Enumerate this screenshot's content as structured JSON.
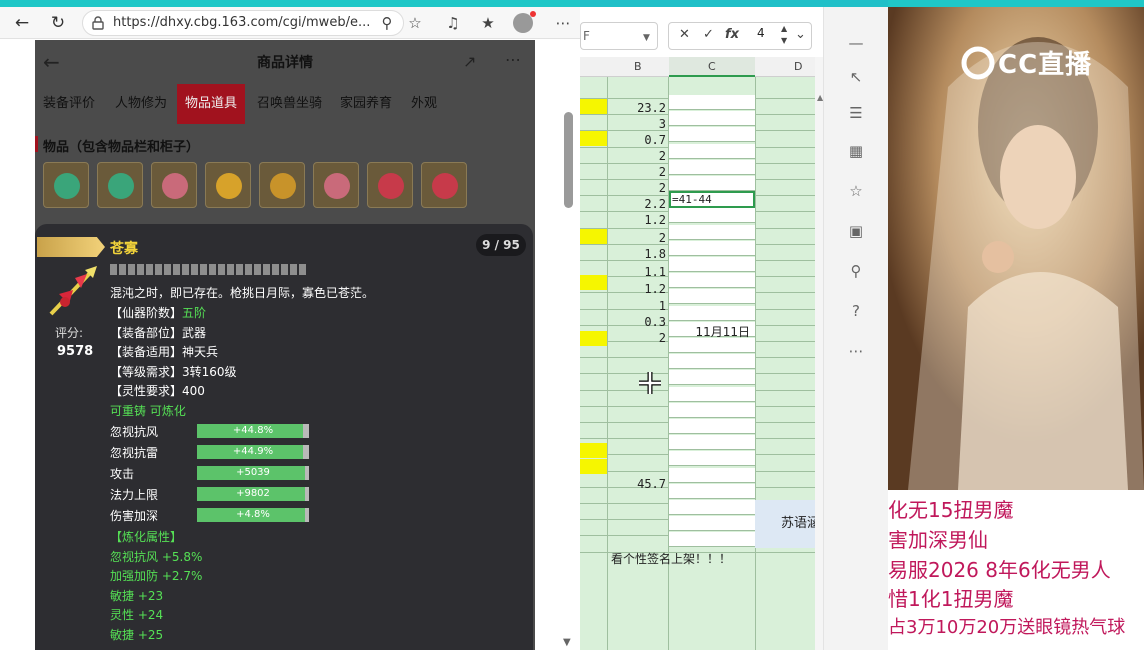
{
  "browser": {
    "url": "https://dhxy.cbg.163.com/cgi/mweb/e...",
    "page_title": "商品详情",
    "tabs": [
      {
        "label": "装备评价"
      },
      {
        "label": "人物修为"
      },
      {
        "label": "物品道具"
      },
      {
        "label": "召唤兽坐骑"
      },
      {
        "label": "家园养育"
      },
      {
        "label": "外观"
      }
    ],
    "section_title": "物品（包含物品栏和柜子）"
  },
  "tooltip": {
    "name": "苍寡",
    "count": "9 / 95",
    "score_label": "评分:",
    "score": "9578",
    "desc": "混沌之时，即已存在。枪挑日月际，寡色已苍茫。",
    "attrs": [
      {
        "key": "【仙器阶数】",
        "val": "五阶",
        "green": true
      },
      {
        "key": "【装备部位】",
        "val": "武器",
        "green": false
      },
      {
        "key": "【装备适用】",
        "val": "神天兵",
        "green": false
      },
      {
        "key": "【等级需求】",
        "val": "3转160级",
        "green": false
      },
      {
        "key": "【灵性要求】",
        "val": "400",
        "green": false
      }
    ],
    "forge": "可重铸 可炼化",
    "stats": [
      {
        "label": "忽视抗风",
        "value": "+44.8%",
        "fill": 0.95
      },
      {
        "label": "忽视抗雷",
        "value": "+44.9%",
        "fill": 0.95
      },
      {
        "label": "攻击",
        "value": "+5039",
        "fill": 0.96
      },
      {
        "label": "法力上限",
        "value": "+9802",
        "fill": 0.96
      },
      {
        "label": "伤害加深",
        "value": "+4.8%",
        "fill": 0.96
      }
    ],
    "refine_title": "【炼化属性】",
    "refine": [
      "忽视抗风 +5.8%",
      "加强加防 +2.7%",
      "敏捷 +23",
      "灵性 +24",
      "敏捷 +25"
    ]
  },
  "sheet": {
    "namebox": "F",
    "formula_value": "4",
    "col_headers": [
      "B",
      "C",
      "D"
    ],
    "b_values": [
      "23.2",
      "3",
      "0.7",
      "2",
      "2",
      "2",
      "2.2",
      "1.2",
      "2",
      "1.8",
      "1.1",
      "1.2",
      "1",
      "0.3",
      "2"
    ],
    "b_total": "45.7",
    "active_cell_text": "=41-44",
    "date_cell": "11月11日",
    "name_cell": "苏语涵",
    "note_cell": "看个性签名上架！！！"
  },
  "stream": {
    "logo": "CC直播",
    "lines": [
      "化无15扭男魔",
      "害加深男仙",
      "易服2026 8年6化无男人",
      "惜1化1扭男魔",
      "占3万10万20万送眼镜热气球"
    ]
  },
  "colors": {
    "accent_red": "#a1121e",
    "sheet_green": "#d9f0d9",
    "highlight_yellow": "#f6f600",
    "stream_text": "#c0185b"
  }
}
